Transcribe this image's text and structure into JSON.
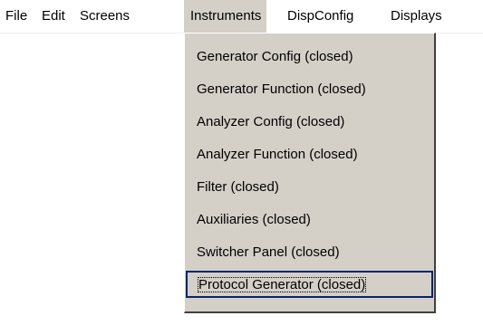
{
  "menubar": {
    "items": [
      {
        "label": "File"
      },
      {
        "label": "Edit"
      },
      {
        "label": "Screens"
      },
      {
        "label": "Instruments"
      },
      {
        "label": "DispConfig"
      },
      {
        "label": "Displays"
      }
    ]
  },
  "dropdown": {
    "items": [
      {
        "label": "Generator Config (closed)"
      },
      {
        "label": "Generator Function (closed)"
      },
      {
        "label": "Analyzer Config (closed)"
      },
      {
        "label": "Analyzer Function (closed)"
      },
      {
        "label": "Filter (closed)"
      },
      {
        "label": "Auxiliaries (closed)"
      },
      {
        "label": "Switcher Panel (closed)"
      },
      {
        "label": "Protocol Generator (closed)"
      }
    ],
    "selected_index": 7
  },
  "colors": {
    "menu_background": "#d4d0c8",
    "highlight_border": "#0a246a"
  }
}
